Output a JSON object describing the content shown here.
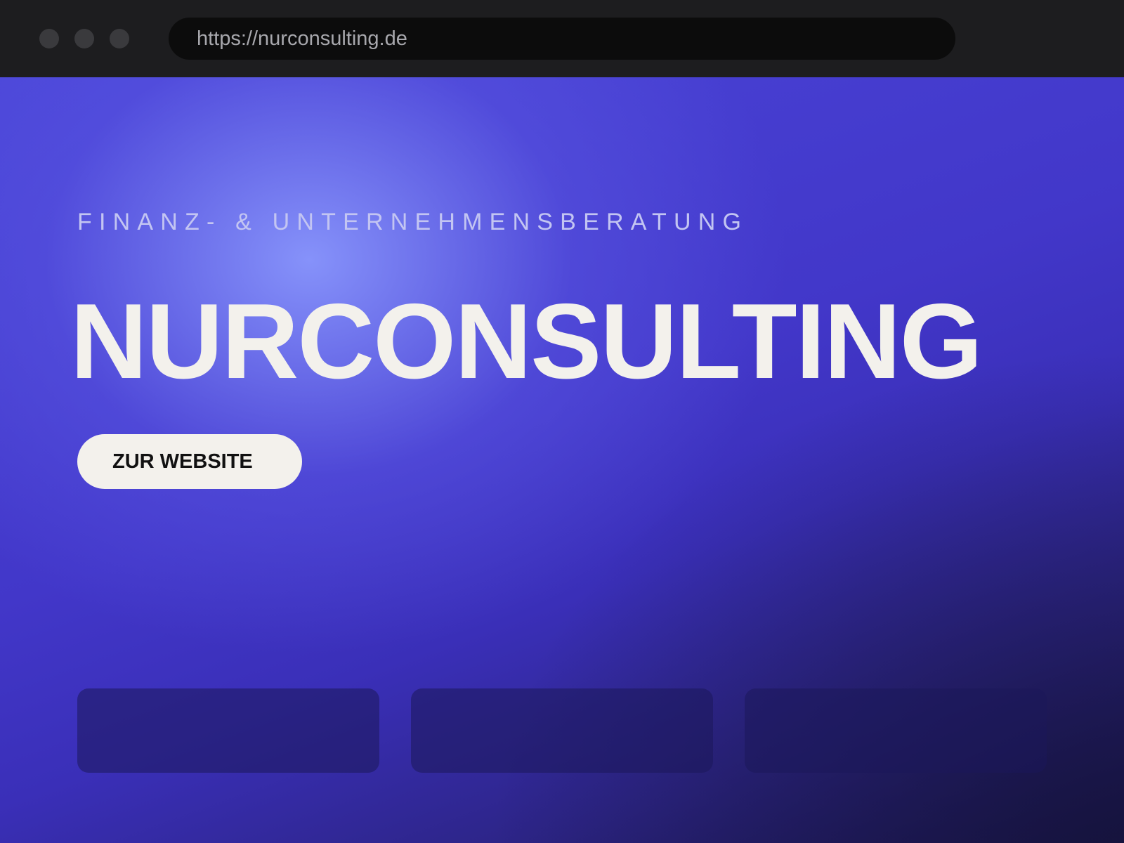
{
  "browser": {
    "url": "https://nurconsulting.de",
    "window_controls": [
      "close-dot",
      "minimize-dot",
      "maximize-dot"
    ]
  },
  "hero": {
    "eyebrow": "FINANZ- & UNTERNEHMENSBERATUNG",
    "title": "NURCONSULTING",
    "cta_label": "ZUR WEBSITE"
  },
  "colors": {
    "chrome_bg": "#1d1d1f",
    "urlbar_bg": "#0c0c0c",
    "hero_primary": "#4237c9",
    "hero_highlight": "#8692fa",
    "text_light": "#f3f1ec",
    "button_text": "#111111"
  }
}
